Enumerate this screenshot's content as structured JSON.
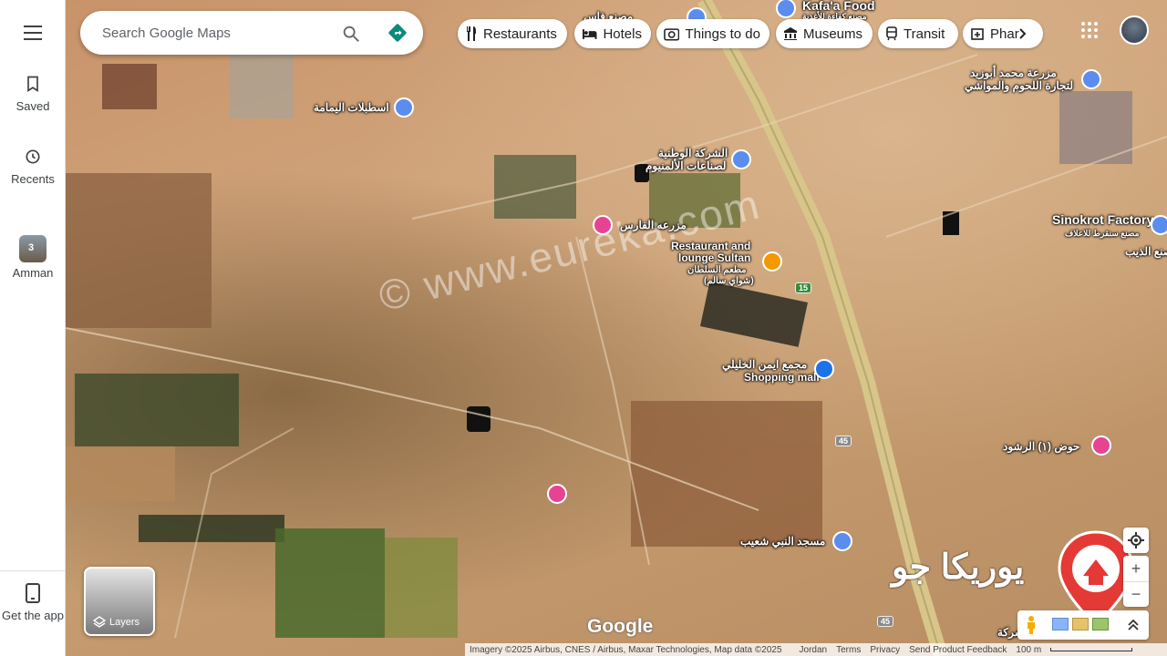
{
  "sidebar": {
    "menu_label": "Menu",
    "saved_label": "Saved",
    "recents_label": "Recents",
    "recent_place_label": "Amman",
    "recent_place_count": "3",
    "get_app_label": "Get the app"
  },
  "search": {
    "placeholder": "Search Google Maps"
  },
  "chips": [
    {
      "label": "Restaurants",
      "icon": "fork-knife-icon"
    },
    {
      "label": "Hotels",
      "icon": "bed-icon"
    },
    {
      "label": "Things to do",
      "icon": "camera-icon"
    },
    {
      "label": "Museums",
      "icon": "museum-icon"
    },
    {
      "label": "Transit",
      "icon": "train-icon"
    },
    {
      "label": "Phar",
      "icon": "pharmacy-icon"
    }
  ],
  "places": {
    "kafa_food": "Kafa'a Food",
    "kafa_food_ar": "مصنع كفاءة للأغذية",
    "fabric_top_ar": "مصنع فاس",
    "istablat": "اسطبلات اليمامة",
    "national_co_1": "الشركة الوطنية",
    "national_co_2": "لصناعات الألمنيوم",
    "farm_faris": "مزرعه الفارس",
    "restaurant_1": "Restaurant and",
    "restaurant_2": "lounge Sultan",
    "restaurant_3": "مطعم السلطان",
    "restaurant_4": "(شواي سالم)",
    "abuzaid_1": "مزرعة محمد أبوزيد",
    "abuzaid_2": "لتجارة اللحوم والمواشي",
    "sinokrot": "Sinokrot Factory",
    "sinokrot_ar": "مصنع سنقرط للاعلاف",
    "deebeh": "مصنع الذيب",
    "mall_ar": "مجمع ايمن الخليلي",
    "mall": "Shopping mall",
    "hawd": "حوض (١) الرشود",
    "mosque": "مسجد النبي شعيب",
    "company_bottom": "شركة"
  },
  "road_badges": {
    "r15": "15",
    "r45a": "45",
    "r45b": "45"
  },
  "watermark": "© www.eureka.com",
  "brand_logo_text": "يوريكا جو",
  "layers_label": "Layers",
  "google_logo": "Google",
  "attribution": {
    "imagery": "Imagery ©2025 Airbus, CNES / Airbus, Maxar Technologies, Map data ©2025",
    "jordan": "Jordan",
    "terms": "Terms",
    "privacy": "Privacy",
    "feedback": "Send Product Feedback",
    "scale": "100 m"
  },
  "colors": {
    "accent_blue": "#1a73e8",
    "directions_teal": "#0b8a7a",
    "hotel_pink": "#e84393",
    "restaurant_orange": "#f29900",
    "pin_blue": "#5b8def",
    "logo_red": "#e53935"
  }
}
